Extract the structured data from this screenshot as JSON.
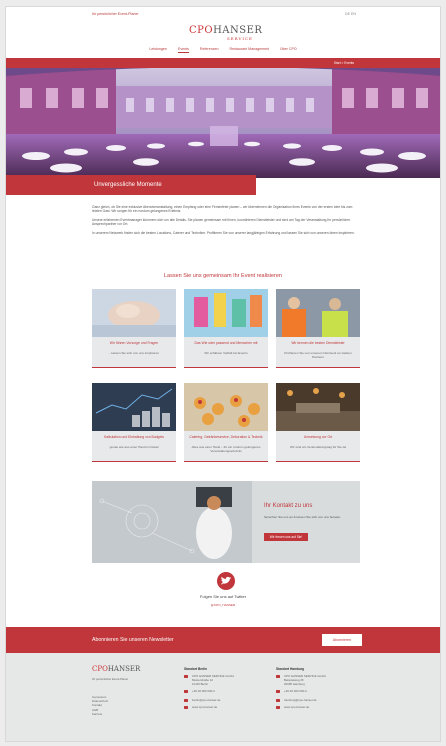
{
  "topbar": {
    "tagline": "Ihr persönlicher Event-Planer",
    "lang": "DE  EN"
  },
  "logo": {
    "cpo": "CPO",
    "hanser": "HANSER",
    "service": "SERVICE"
  },
  "nav": [
    "Leistungen",
    "Events",
    "Referenzen",
    "Restaurant Management",
    "Über CPO"
  ],
  "breadcrumb": "Start > Events",
  "hero_title": "Unvergessliche Momente",
  "intro": [
    "Ganz gleich, ob Sie eine exklusive Abendveranstaltung, einen Empfang oder eine Firmenfeier planen – wir übernehmen die Organisation Ihres Events von der ersten Idee bis zum letzten Gast. Wir sorgen für ein rundum gelungenes Erlebnis.",
    "Unsere erfahrenen Eventmanager kümmern sich um alle Details. Sie planen gemeinsam mit Ihnen, koordinieren Dienstleister und sind am Tag der Veranstaltung Ihr persönlicher Ansprechpartner vor Ort.",
    "In unserem Netzwerk finden sich die besten Locations, Caterer und Techniker. Profitieren Sie von unserer langjährigen Erfahrung und lassen Sie sich von unseren Ideen inspirieren."
  ],
  "section_title": "Lassen Sie uns gemeinsam Ihr Event realisieren",
  "cards": [
    {
      "title": "Wir führen Vorsorge und Fragen",
      "text": "...lassen Sie sich von uns inspirieren"
    },
    {
      "title": "Das Wie oder passend und Menschen mit",
      "text": "Wir schätzen Vielfalt bei Events"
    },
    {
      "title": "Wir kennen die besten Dienstleister",
      "text": "Profitieren Sie von unserem Netzwerk an starken Partnern"
    },
    {
      "title": "Kalkulation und Einhaltung von Budgets",
      "text": "genau wie aus einer Hand im Detail"
    },
    {
      "title": "Catering, Getränkeservice, Dekoration & Technik",
      "text": "Alles aus einer Hand – für ein rundum gelungenes Veranstaltungserlebnis"
    },
    {
      "title": "Umsetzung vor Ort",
      "text": "Wir sind am Veranstaltungstag für Sie da"
    }
  ],
  "contact": {
    "title": "Ihr Kontakt zu uns",
    "text": "Sprechen Sie uns an & lassen Sie sich von uns beraten.",
    "button": "Wir freuen uns auf Sie!"
  },
  "twitter": {
    "title": "Folgen Sie uns auf Twitter",
    "link": "@CPO_HANSER"
  },
  "newsletter": {
    "title": "Abonnieren Sie unseren Newsletter",
    "button": "Abonnieren"
  },
  "footer": {
    "tagline": "Ihr persönlicher Event-Planer",
    "links": [
      "Impressum",
      "Datenschutz",
      "Kontakt",
      "AGB",
      "Karriere"
    ],
    "col1": {
      "heading": "Standort Berlin",
      "address": [
        "CPO HANSER SERVICE GmbH",
        "Musterstraße 12",
        "10115 Berlin"
      ],
      "phone": "+49 30 000 000-0",
      "email": "berlin@cpo-hanser.de",
      "web": "www.cpo-hanser.de"
    },
    "col2": {
      "heading": "Standort Hamburg",
      "address": [
        "CPO HANSER SERVICE GmbH",
        "Beispielweg 45",
        "20095 Hamburg"
      ],
      "phone": "+49 40 000 000-0",
      "email": "hamburg@cpo-hanser.de",
      "web": "www.cpo-hanser.de"
    }
  },
  "colors": {
    "accent": "#c0363a"
  }
}
